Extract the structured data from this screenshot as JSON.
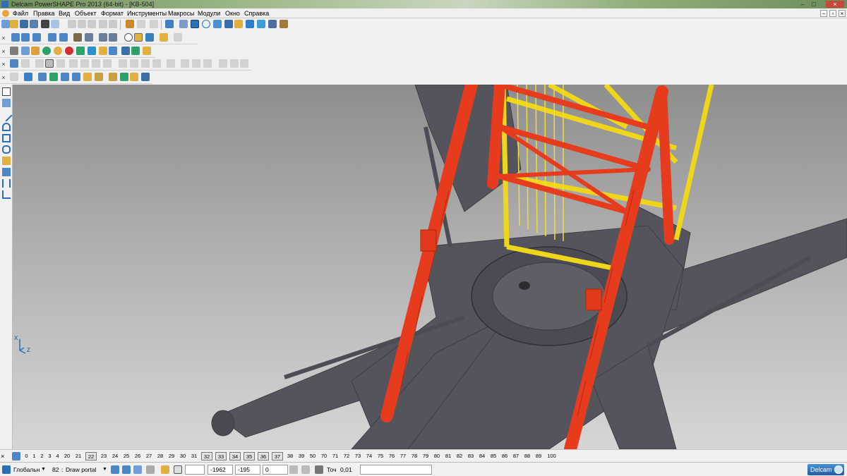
{
  "window": {
    "title": "Delcam PowerSHAPE Pro 2013 (64-bit) - [KB-504]",
    "minimize": "–",
    "maximize": "□",
    "close": "×"
  },
  "menu": {
    "items": [
      "Файл",
      "Правка",
      "Вид",
      "Объект",
      "Формат",
      "Инструменты",
      "Макросы",
      "Модули",
      "Окно",
      "Справка"
    ],
    "mdi": [
      "–",
      "▫",
      "×"
    ]
  },
  "toolbars": {
    "handle_glyphs": [
      "×",
      "×",
      "×",
      "×",
      "×"
    ]
  },
  "viewport": {
    "triad_axis_x": "X",
    "triad_axis_z": "Z",
    "colors": {
      "tower_red": "#e63b1c",
      "tower_yellow": "#f0d61a",
      "steel_gray": "#55565d"
    }
  },
  "levels": {
    "icon": "levels-icon",
    "values": [
      "0",
      "1",
      "2",
      "3",
      "4",
      "20",
      "21",
      "22",
      "23",
      "24",
      "25",
      "26",
      "27",
      "28",
      "29",
      "30",
      "31",
      "32",
      "33",
      "34",
      "35",
      "36",
      "37",
      "38",
      "39",
      "50",
      "70",
      "71",
      "72",
      "73",
      "74",
      "75",
      "76",
      "77",
      "78",
      "79",
      "80",
      "81",
      "82",
      "83",
      "84",
      "85",
      "86",
      "87",
      "88",
      "89",
      "100"
    ],
    "boxed": [
      "22",
      "32",
      "33",
      "34",
      "35",
      "36",
      "37"
    ]
  },
  "status": {
    "workplane": "Глобальн",
    "level_number": "82",
    "level_name": "Draw portal",
    "coord_x": "-1962",
    "coord_y": "-195",
    "coord_z": "0",
    "tolerance_label": "Точ",
    "tolerance_value": "0,01",
    "brand": "Delcam"
  }
}
